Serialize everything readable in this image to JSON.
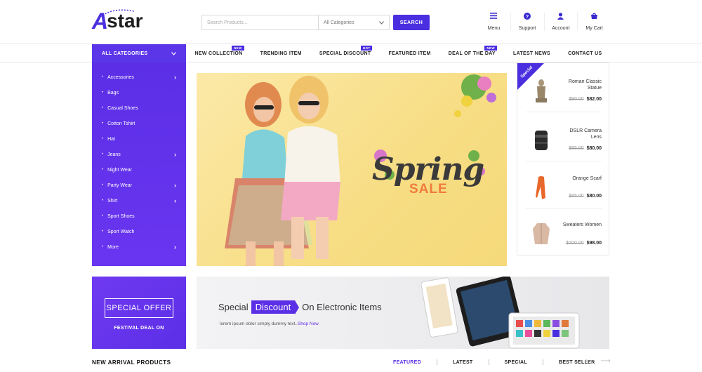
{
  "brand": {
    "logo_letter": "A",
    "logo_rest": "star",
    "accent": "#5b2fe6"
  },
  "search": {
    "placeholder": "Search Products...",
    "category": "All Categories",
    "button": "SEARCH"
  },
  "header_icons": [
    {
      "icon": "menu-icon",
      "label": "Menu"
    },
    {
      "icon": "help-icon",
      "label": "Support"
    },
    {
      "icon": "user-icon",
      "label": "Account"
    },
    {
      "icon": "cart-icon",
      "label": "My Cart"
    }
  ],
  "nav": {
    "all_categories": "ALL CATEGORIES",
    "links": [
      {
        "label": "NEW COLLECTION",
        "badge": "NEW"
      },
      {
        "label": "TRENDING ITEM",
        "badge": ""
      },
      {
        "label": "SPECIAL DISCOUNT",
        "badge": "HOT"
      },
      {
        "label": "FEATURED ITEM",
        "badge": ""
      },
      {
        "label": "DEAL OF THE DAY",
        "badge": "NEW"
      },
      {
        "label": "LATEST NEWS",
        "badge": ""
      },
      {
        "label": "CONTACT US",
        "badge": ""
      }
    ]
  },
  "sidebar": {
    "items": [
      {
        "label": "Accessories",
        "has_sub": true
      },
      {
        "label": "Bags",
        "has_sub": false
      },
      {
        "label": "Casual Shoes",
        "has_sub": false
      },
      {
        "label": "Cotton Tshirt",
        "has_sub": false
      },
      {
        "label": "Hat",
        "has_sub": false
      },
      {
        "label": "Jeans",
        "has_sub": true
      },
      {
        "label": "Night Wear",
        "has_sub": false
      },
      {
        "label": "Party Wear",
        "has_sub": true
      },
      {
        "label": "Shirt",
        "has_sub": true
      },
      {
        "label": "Sport Shoes",
        "has_sub": false
      },
      {
        "label": "Sport Watch",
        "has_sub": false
      },
      {
        "label": "More",
        "has_sub": true
      }
    ]
  },
  "banner": {
    "title": "Spring",
    "subtitle": "SALE"
  },
  "special": {
    "tag": "Special",
    "products": [
      {
        "name": "Roman Classic Statue",
        "old_price": "$90.00",
        "price": "$82.00"
      },
      {
        "name": "DSLR Camera Lens",
        "old_price": "$85.00",
        "price": "$80.00"
      },
      {
        "name": "Orange Scarf",
        "old_price": "$85.00",
        "price": "$80.00"
      },
      {
        "name": "Sweaters Women",
        "old_price": "$100.00",
        "price": "$98.00"
      }
    ]
  },
  "offer": {
    "title": "SPECIAL OFFER",
    "subtitle": "FESTIVAL DEAL ON"
  },
  "electronics": {
    "prefix": "Special",
    "highlight": "Discount",
    "suffix": "On Electronic Items",
    "text": "lorem ipsum dolor simply dummy text..",
    "link": "Shop Now"
  },
  "arrivals": {
    "title": "NEW ARRIVAL PRODUCTS",
    "tabs": [
      "FEATURED",
      "LATEST",
      "SPECIAL",
      "BEST SELLER"
    ]
  }
}
